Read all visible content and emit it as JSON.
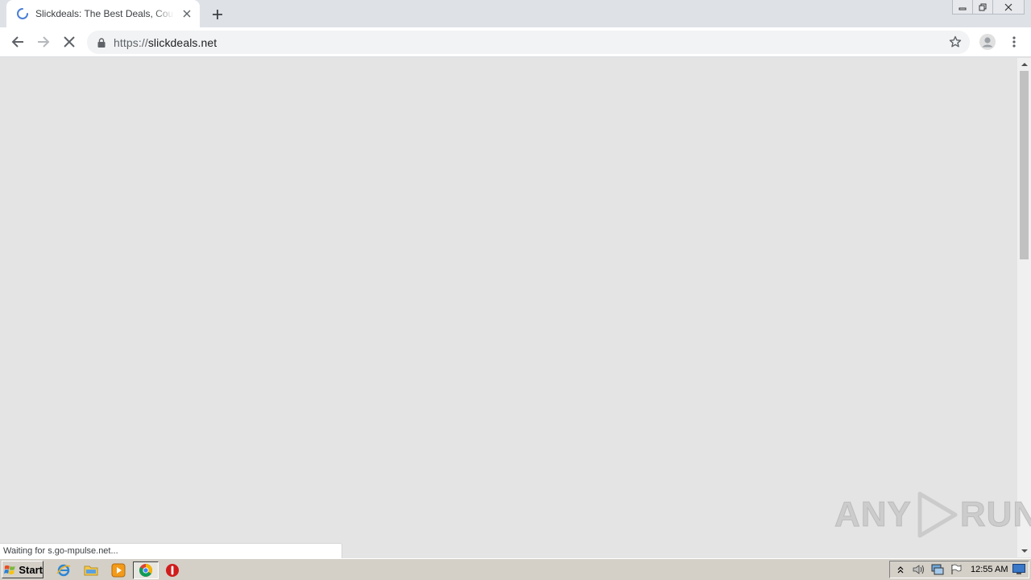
{
  "browser": {
    "tab": {
      "title": "Slickdeals: The Best Deals, Coupons",
      "loading": true
    },
    "new_tab_symbol": "+",
    "address": {
      "scheme": "https://",
      "host": "slickdeals.net"
    },
    "status_text": "Waiting for s.go-mpulse.net..."
  },
  "watermark": {
    "left": "ANY",
    "right": "RUN"
  },
  "taskbar": {
    "start_label": "Start",
    "quick_launch": [
      "internet-explorer-icon",
      "file-explorer-icon",
      "media-player-icon",
      "chrome-icon",
      "stop-icon"
    ],
    "clock": "12:55 AM"
  },
  "colors": {
    "page_background": "#e4e4e4",
    "tabstrip": "#dee1e6",
    "omnibox": "#f1f3f4",
    "taskbar": "#d4d0c8"
  }
}
